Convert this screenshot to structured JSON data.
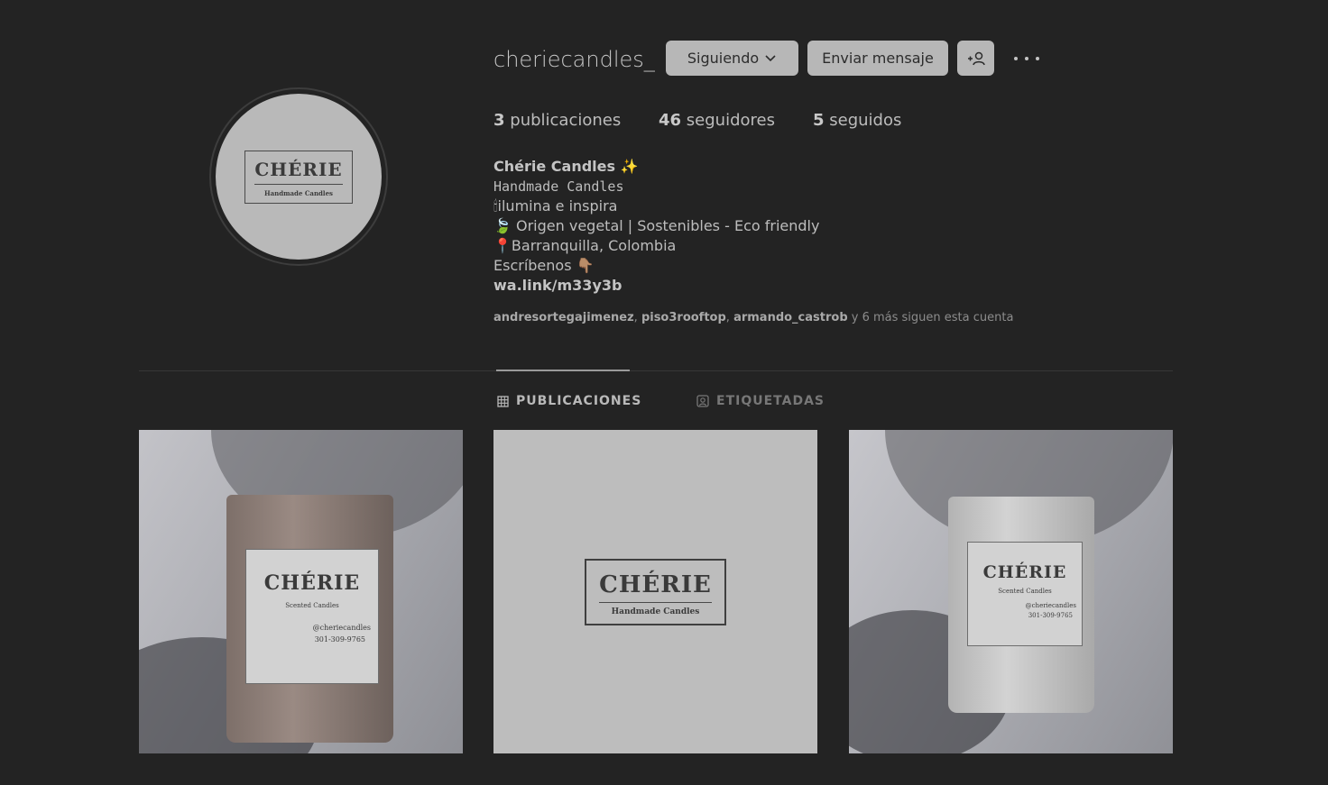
{
  "profile": {
    "username": "cheriecandles_",
    "avatar_logo_title": "CHÉRIE",
    "avatar_logo_sub": "Handmade Candles",
    "follow_label": "Siguiendo",
    "message_label": "Enviar mensaje",
    "add_user_icon": "add-user-icon",
    "more_icon": "more-options-icon"
  },
  "stats": {
    "posts_count": "3",
    "posts_label": "publicaciones",
    "followers_count": "46",
    "followers_label": "seguidores",
    "following_count": "5",
    "following_label": "seguidos"
  },
  "bio": {
    "name": "Chérie Candles ✨",
    "line1": "Handmade Candles",
    "line2": "🕯ilumina e inspira",
    "line3": "🍃 Origen vegetal | Sostenibles - Eco friendly",
    "line4": "📍Barranquilla, Colombia",
    "line5": "Escríbenos 👇🏽",
    "link": "wa.link/m33y3b"
  },
  "followed_by": {
    "user1": "andresortegajimenez",
    "sep1": ", ",
    "user2": "piso3rooftop",
    "sep2": ", ",
    "user3": "armando_castrob",
    "rest": " y 6 más siguen esta cuenta"
  },
  "tabs": {
    "posts": "PUBLICACIONES",
    "tagged": "ETIQUETADAS"
  },
  "posts": [
    {
      "logo_title": "CHÉRIE",
      "sub": "Scented Candles",
      "handle": "@cheriecandles",
      "phone": "301-309-9765"
    },
    {
      "logo_title": "CHÉRIE",
      "sub": "Handmade Candles"
    },
    {
      "logo_title": "CHÉRIE",
      "sub": "Scented Candles",
      "handle": "@cheriecandles",
      "phone": "301-309-9765"
    }
  ],
  "colors": {
    "background": "#232323",
    "button": "#b7b7b7"
  }
}
